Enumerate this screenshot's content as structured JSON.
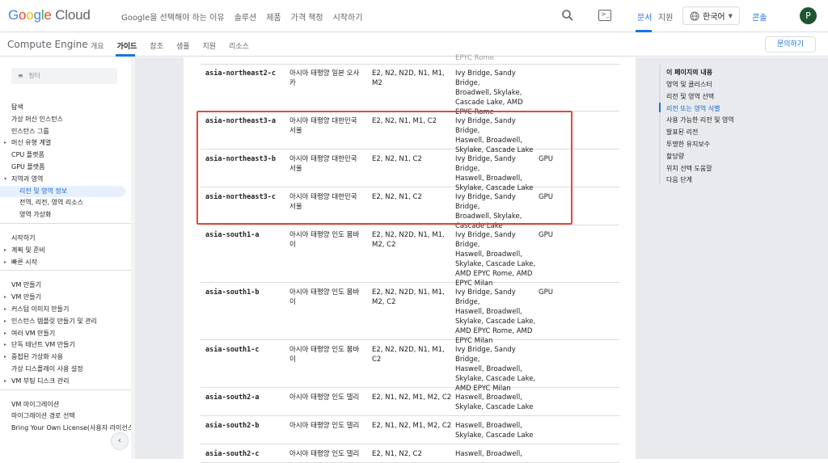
{
  "header": {
    "logo_google": "Google",
    "logo_cloud": "Cloud",
    "nav": [
      "Google을 선택해야 하는 이유",
      "솔루션",
      "제품",
      "가격 책정",
      "시작하기"
    ],
    "docs": "문서",
    "support": "지원",
    "language": "한국어",
    "console": "콘솔",
    "avatar_initial": "P"
  },
  "subheader": {
    "product": "Compute Engine",
    "tabs": [
      "개요",
      "가이드",
      "참조",
      "샘플",
      "지원",
      "리소스"
    ],
    "active_tab": "가이드",
    "contact": "문의하기"
  },
  "sidebar": {
    "filter_placeholder": "필터",
    "items": [
      {
        "label": "탐색",
        "type": "head"
      },
      {
        "label": "가상 머신 인스턴스"
      },
      {
        "label": "인스턴스 그룹"
      },
      {
        "label": "머신 유형 계열",
        "arrow": true
      },
      {
        "label": "CPU 플랫폼"
      },
      {
        "label": "GPU 플랫폼"
      },
      {
        "label": "지역과 영역",
        "arrow": true,
        "open": true
      },
      {
        "label": "리전 및 영역 정보",
        "sub": true,
        "selected": true
      },
      {
        "label": "전역, 리전, 영역 리소스",
        "sub": true
      },
      {
        "label": "영역 가상화",
        "sub": true
      },
      {
        "label": "시작하기",
        "type": "head"
      },
      {
        "label": "계획 및 준비",
        "arrow": true
      },
      {
        "label": "빠른 시작",
        "arrow": true
      },
      {
        "label": "VM 만들기",
        "type": "head"
      },
      {
        "label": "VM 만들기",
        "arrow": true
      },
      {
        "label": "커스텀 이미지 만들기",
        "arrow": true
      },
      {
        "label": "인스턴스 템플릿 만들기 및 관리",
        "arrow": true
      },
      {
        "label": "여러 VM 만들기",
        "arrow": true
      },
      {
        "label": "단독 테넌트 VM 만들기",
        "arrow": true
      },
      {
        "label": "중첩된 가상화 사용",
        "arrow": true
      },
      {
        "label": "가상 디스플레이 사용 설정"
      },
      {
        "label": "VM 부팅 디스크 관리",
        "arrow": true
      },
      {
        "label": "VM 마이그레이션",
        "type": "head"
      },
      {
        "label": "마이그레이션 경로 선택"
      },
      {
        "label": "Bring Your Own License(사용자 라이선스 사용)"
      }
    ],
    "arrow_glyph": "▸",
    "collapse_glyph": "‹"
  },
  "toc": {
    "title": "이 페이지의 내용",
    "items": [
      "영역 및 클러스터",
      "리전 및 영역 선택",
      "리전 또는 영역 식별",
      "사용 가능한 리전 및 영역",
      "발표된 리전",
      "투명한 유지보수",
      "할당량",
      "위치 선택 도움말",
      "다음 단계"
    ],
    "active": "리전 또는 영역 식별"
  },
  "table": {
    "top_cut_text": "EPYC Rome",
    "rows": [
      {
        "zone": "asia-northeast2-c",
        "location": [
          "아시아 태평양 일본 오사",
          "카"
        ],
        "machines": [
          "E2, N2, N2D, N1, M1, M2"
        ],
        "cpus": [
          "Ivy Bridge, Sandy Bridge,",
          "Broadwell, Skylake,",
          "Cascade Lake, AMD",
          "EPYC Rome"
        ],
        "gpu": ""
      },
      {
        "zone": "asia-northeast3-a",
        "location": [
          "아시아 태평양 대한민국",
          "서울"
        ],
        "machines": [
          "E2, N2, N1, M1, C2"
        ],
        "cpus": [
          "Ivy Bridge, Sandy Bridge,",
          "Haswell, Broadwell,",
          "Skylake, Cascade Lake"
        ],
        "gpu": ""
      },
      {
        "zone": "asia-northeast3-b",
        "location": [
          "아시아 태평양 대한민국",
          "서울"
        ],
        "machines": [
          "E2, N2, N1, C2"
        ],
        "cpus": [
          "Ivy Bridge, Sandy Bridge,",
          "Haswell, Broadwell,",
          "Skylake, Cascade Lake"
        ],
        "gpu": "GPU"
      },
      {
        "zone": "asia-northeast3-c",
        "location": [
          "아시아 태평양 대한민국",
          "서울"
        ],
        "machines": [
          "E2, N2, N1, C2"
        ],
        "cpus": [
          "Ivy Bridge, Sandy Bridge,",
          "Broadwell, Skylake,",
          "Cascade Lake"
        ],
        "gpu": "GPU"
      },
      {
        "zone": "asia-south1-a",
        "location": [
          "아시아 태평양 인도 뭄바",
          "이"
        ],
        "machines": [
          "E2, N2, N2D, N1, M1,",
          "M2, C2"
        ],
        "cpus": [
          "Ivy Bridge, Sandy Bridge,",
          "Haswell, Broadwell,",
          "Skylake, Cascade Lake,",
          "AMD EPYC Rome, AMD",
          "EPYC Milan"
        ],
        "gpu": "GPU"
      },
      {
        "zone": "asia-south1-b",
        "location": [
          "아시아 태평양 인도 뭄바",
          "이"
        ],
        "machines": [
          "E2, N2, N2D, N1, M1,",
          "M2, C2"
        ],
        "cpus": [
          "Ivy Bridge, Sandy Bridge,",
          "Haswell, Broadwell,",
          "Skylake, Cascade Lake,",
          "AMD EPYC Rome, AMD",
          "EPYC Milan"
        ],
        "gpu": "GPU"
      },
      {
        "zone": "asia-south1-c",
        "location": [
          "아시아 태평양 인도 뭄바",
          "이"
        ],
        "machines": [
          "E2, N2, N2D, N1, M1, C2"
        ],
        "cpus": [
          "Ivy Bridge, Sandy Bridge,",
          "Haswell, Broadwell,",
          "Skylake, Cascade Lake,",
          "AMD EPYC Milan"
        ],
        "gpu": ""
      },
      {
        "zone": "asia-south2-a",
        "location": [
          "아시아 태평양 인도 델리"
        ],
        "machines": [
          "E2, N1, N2, M1, M2, C2"
        ],
        "cpus": [
          "Haswell, Broadwell,",
          "Skylake, Cascade Lake"
        ],
        "gpu": ""
      },
      {
        "zone": "asia-south2-b",
        "location": [
          "아시아 태평양 인도 델리"
        ],
        "machines": [
          "E2, N1, N2, M1, M2, C2"
        ],
        "cpus": [
          "Haswell, Broadwell,",
          "Skylake, Cascade Lake"
        ],
        "gpu": ""
      },
      {
        "zone": "asia-south2-c",
        "location": [
          "아시아 태평양 인도 델리"
        ],
        "machines": [
          "E2, N1, N2, C2"
        ],
        "cpus": [
          "Haswell, Broadwell,"
        ],
        "gpu": ""
      }
    ]
  },
  "colors": {
    "accent": "#1a73e8",
    "highlight_border": "#e04a3a",
    "gutter": "#e8eaed"
  }
}
